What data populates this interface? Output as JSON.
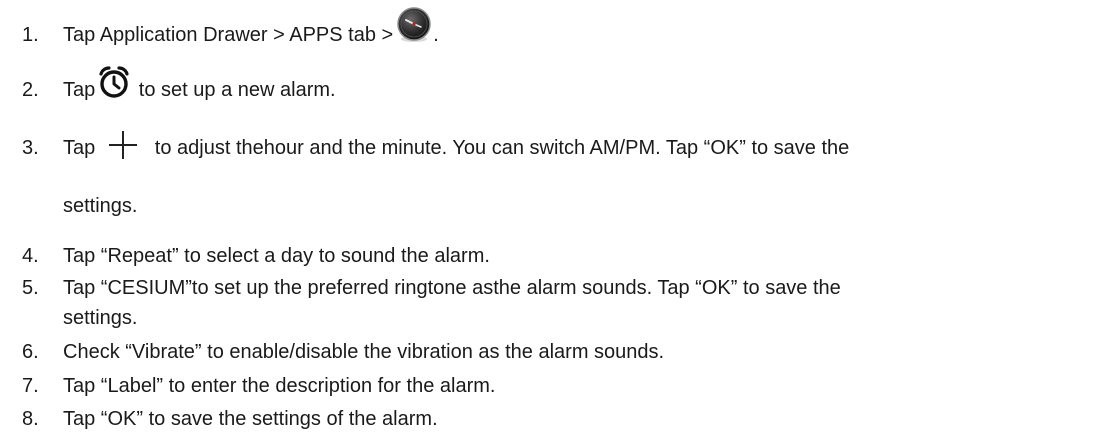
{
  "steps": [
    {
      "num": "1.",
      "before": "Tap Application Drawer > APPS tab >",
      "icon": "clock-app-icon",
      "after": "."
    },
    {
      "num": "2.",
      "before": "Tap",
      "icon": "add-alarm-icon",
      "after": " to set up a new alarm."
    },
    {
      "num": "3.",
      "before": "Tap",
      "icon": "plus-icon",
      "after": " to adjust thehour and the minute. You can switch AM/PM. Tap “OK” to save the",
      "continuation": "settings."
    },
    {
      "num": "4.",
      "text": "Tap “Repeat” to select a day to sound the alarm."
    },
    {
      "num": "5.",
      "text": "Tap “CESIUM”to set up the preferred ringtone asthe alarm sounds. Tap “OK” to save the",
      "continuation": "settings."
    },
    {
      "num": "6.",
      "text": "Check “Vibrate” to enable/disable the vibration as the alarm sounds."
    },
    {
      "num": "7.",
      "text": "Tap “Label” to enter the description for the alarm."
    },
    {
      "num": "8.",
      "text": "Tap “OK” to save the settings of the alarm."
    }
  ]
}
